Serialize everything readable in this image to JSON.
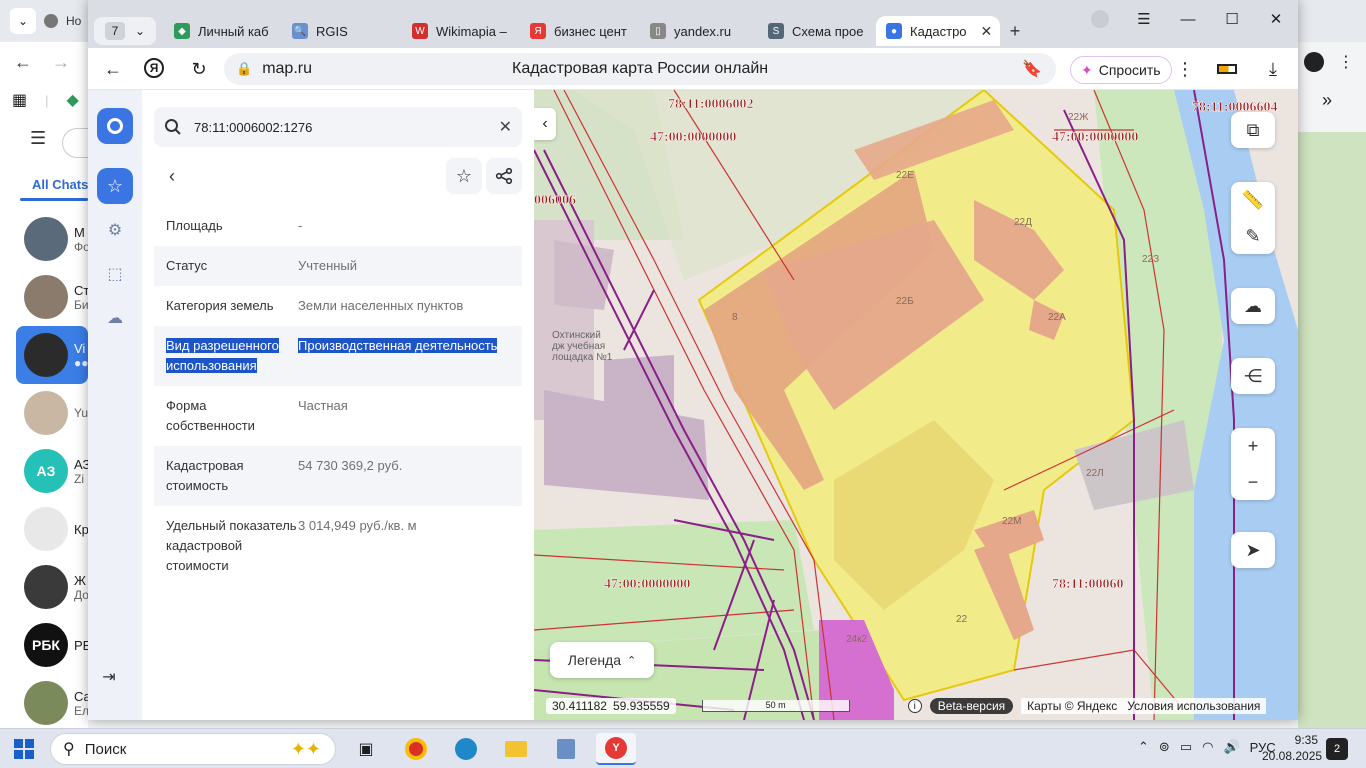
{
  "background": {
    "first_tab_label": "Но",
    "chats_tab": "All Chats",
    "chats": [
      {
        "initial": "M",
        "sub": "Фо",
        "color": "#5a6a7a"
      },
      {
        "initial": "Ст",
        "sub": "Би",
        "color": "#8a7b6c"
      },
      {
        "initial": "Vi",
        "sub": "●●",
        "color": "#2b2b2b",
        "active": true
      },
      {
        "initial": "",
        "sub": "Yu",
        "color": "#c9b7a4"
      },
      {
        "initial": "АЗ",
        "sub": "Zi",
        "color": "#25c1b6",
        "avatar_text": "АЗ"
      },
      {
        "initial": "Кр",
        "sub": "",
        "color": "#e8e8e8"
      },
      {
        "initial": "Ж",
        "sub": "До",
        "color": "#3a3a3a"
      },
      {
        "initial": "РБ",
        "sub": "",
        "color": "#111111",
        "avatar_text": "РБК"
      },
      {
        "initial": "Са",
        "sub": "Ел",
        "color": "#7a8a5a"
      }
    ]
  },
  "browser": {
    "tab_group_count": "7",
    "tabs": [
      {
        "label": "Личный каб",
        "fav_color": "#2f9a5a",
        "fav": "◆"
      },
      {
        "label": "RGIS",
        "fav_color": "#6b8fd1",
        "fav": "🔍"
      },
      {
        "label": "Wikimapia –",
        "fav_color": "#d32f2f",
        "fav": "W"
      },
      {
        "label": "бизнес цент",
        "fav_color": "#e53935",
        "fav": "Я"
      },
      {
        "label": "yandex.ru",
        "fav_color": "#888888",
        "fav": "▯"
      },
      {
        "label": "Схема прое",
        "fav_color": "#556677",
        "fav": "S"
      },
      {
        "label": "Кадастро",
        "fav_color": "#3a75e3",
        "fav": "●",
        "active": true
      }
    ],
    "address_host": "map.ru",
    "page_title": "Кадастровая карта России онлайн",
    "ask_label": "Спросить"
  },
  "panel": {
    "search_query": "78:11:0006002:1276",
    "properties": [
      {
        "key": "Площадь",
        "value": "-"
      },
      {
        "key": "Статус",
        "value": "Учтенный"
      },
      {
        "key": "Категория земель",
        "value": "Земли населенных пунктов"
      },
      {
        "key": "Вид разрешенного использования",
        "value": "Производственная деятельность",
        "selected": true
      },
      {
        "key": "Форма собственности",
        "value": "Частная"
      },
      {
        "key": "Кадастровая стоимость",
        "value": "54 730 369,2 руб."
      },
      {
        "key": "Удельный показатель кадастровой стоимости",
        "value": "3 014,949 руб./кв. м"
      }
    ]
  },
  "map": {
    "labels": [
      {
        "text": "78:11:0006002"
      },
      {
        "text": "78:11:0006604"
      },
      {
        "text": "47:00:0000000"
      },
      {
        "text": "006006"
      },
      {
        "text": "47:00:0000000"
      },
      {
        "text": "47:00:0000000"
      },
      {
        "text": "78:11:00060"
      }
    ],
    "building_labels": [
      "22Е",
      "22Ж",
      "22Д",
      "22Б",
      "22А",
      "22З",
      "22Л",
      "22М",
      "22",
      "24к2",
      "8"
    ],
    "poi": [
      "Охтинский",
      "дж учебная",
      "лощадка №1"
    ],
    "legend": "Легенда",
    "lon": "30.411182",
    "lat": "59.935559",
    "scale": "50 m",
    "beta": "Beta-версия",
    "copyright": "Карты © Яндекс",
    "terms": "Условия использования"
  },
  "taskbar": {
    "search": "Поиск",
    "lang": "РУС",
    "time": "9:35",
    "date": "20.08.2025",
    "notifications": "2"
  }
}
